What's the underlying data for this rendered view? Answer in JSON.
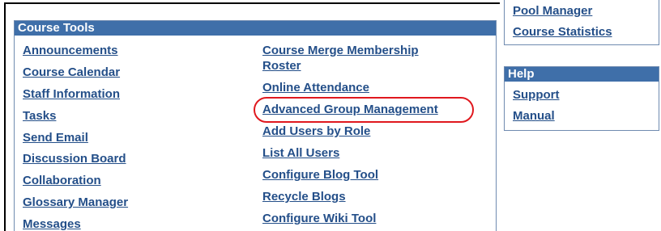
{
  "course_tools": {
    "header": "Course Tools",
    "left_column": [
      "Announcements",
      "Course Calendar",
      "Staff Information",
      "Tasks",
      "Send Email",
      "Discussion Board",
      "Collaboration",
      "Glossary Manager",
      "Messages"
    ],
    "right_column": [
      "Course Merge Membership",
      "Roster",
      "Online Attendance",
      "Advanced Group Management",
      "Add Users by Role",
      "List All Users",
      "Configure Blog Tool",
      "Recycle Blogs",
      "Configure Wiki Tool"
    ],
    "highlighted_item": "Advanced Group Management"
  },
  "top_right_links": [
    "Pool Manager",
    "Course Statistics"
  ],
  "help": {
    "header": "Help",
    "links": [
      "Support",
      "Manual"
    ]
  },
  "colors": {
    "header_bg": "#3f6fa9",
    "link": "#244f89",
    "highlight": "#e0181e"
  }
}
